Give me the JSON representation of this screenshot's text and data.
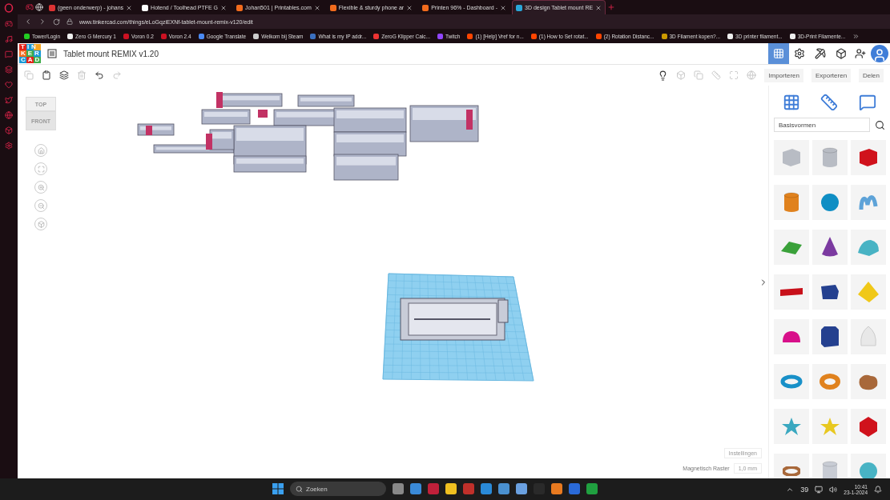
{
  "browser": {
    "tabs": [
      {
        "title": "(geen onderwerp) - johans",
        "selected": false
      },
      {
        "title": "Hotend / Toolhead PTFE G",
        "selected": false
      },
      {
        "title": "Johan501 | Printables.com",
        "selected": false
      },
      {
        "title": "Flexible & sturdy phone ar",
        "selected": false
      },
      {
        "title": "Printen 96% - Dashboard -",
        "selected": false
      },
      {
        "title": "3D design Tablet mount RE",
        "selected": true
      }
    ],
    "url": "www.tinkercad.com/things/eLoGqziEXNf-tablet-mount-remix-v120/edit",
    "bookmarks": [
      "Tower/Login",
      "Zero G Mercury 1",
      "Voron 0.2",
      "Voron 2.4",
      "Google Translate",
      "Welkom bij Steam",
      "What is my IP addr...",
      "ZeroG Klipper Calc...",
      "Twitch",
      "(1) [Help] Vref for n...",
      "(1) How to Set rotat...",
      "(2) Rotation Distanc...",
      "3D Filament kopen?...",
      "3D printer filament...",
      "3D-Print Filamente..."
    ]
  },
  "app": {
    "logo": [
      "TIN",
      "KER",
      "CAD"
    ],
    "title": "Tablet mount REMIX v1.20",
    "view_modes": [
      {
        "selected": true
      },
      {
        "selected": false
      },
      {
        "selected": false
      },
      {
        "selected": false
      }
    ],
    "actions": [
      "Importeren",
      "Exporteren",
      "Delen"
    ],
    "view_cube": {
      "top": "TOP",
      "front": "FRONT"
    },
    "library": "Basisvormen",
    "shapes": [
      {
        "kind": "box",
        "color": "#b8bcc4"
      },
      {
        "kind": "cylinder",
        "color": "#b8bcc4"
      },
      {
        "kind": "box",
        "color": "#d0121c"
      },
      {
        "kind": "cylinder",
        "color": "#e0821e"
      },
      {
        "kind": "sphere",
        "color": "#0f8ec4"
      },
      {
        "kind": "scribble",
        "color": "#5ea3d8"
      },
      {
        "kind": "roof",
        "color": "#3aa13a"
      },
      {
        "kind": "cone",
        "color": "#7b3aa0"
      },
      {
        "kind": "roundroof",
        "color": "#48b3c4"
      },
      {
        "kind": "text",
        "color": "#c8101a"
      },
      {
        "kind": "prism",
        "color": "#24408f"
      },
      {
        "kind": "pyramid",
        "color": "#f0c818"
      },
      {
        "kind": "halfsphere",
        "color": "#d8108a"
      },
      {
        "kind": "hexprism",
        "color": "#24408f"
      },
      {
        "kind": "paraboloid",
        "color": "#e8e8e8"
      },
      {
        "kind": "torus",
        "color": "#1890c8"
      },
      {
        "kind": "tube",
        "color": "#e0821e"
      },
      {
        "kind": "blob",
        "color": "#a8683a"
      },
      {
        "kind": "star",
        "color": "#3aa8c0"
      },
      {
        "kind": "star",
        "color": "#e8c820"
      },
      {
        "kind": "icosahedron",
        "color": "#d0121c"
      },
      {
        "kind": "ring",
        "color": "#a8683a"
      },
      {
        "kind": "cylinder",
        "color": "#c8ccd4"
      },
      {
        "kind": "sphere",
        "color": "#48b3c4"
      }
    ],
    "settings": "Instellingen",
    "snap_label": "Magnetisch Raster",
    "snap_value": "1,0 mm"
  },
  "taskbar": {
    "search": "Zoeken",
    "temperature": "39",
    "time": "10:41",
    "date": "23-1-2024"
  }
}
